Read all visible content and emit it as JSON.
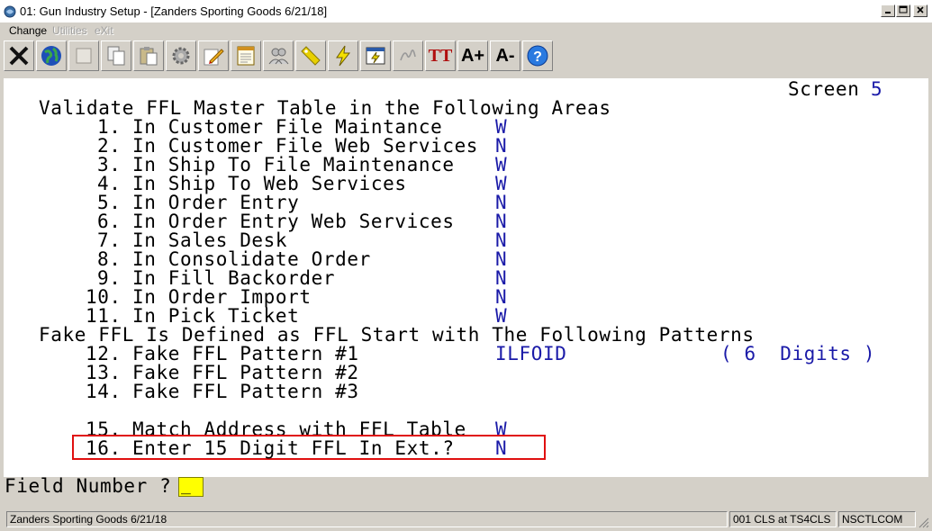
{
  "window": {
    "title": "01: Gun Industry Setup - [Zanders Sporting Goods 6/21/18]",
    "icon": "app-icon",
    "controls": [
      "minimize",
      "maximize",
      "close"
    ]
  },
  "menu": {
    "change": "Change",
    "utilities": "Utilities",
    "exit": "eXit"
  },
  "toolbar": {
    "buttons": [
      "close-x-icon",
      "globe-icon",
      "blank-icon",
      "copy-icon",
      "paste-icon",
      "settings-icon",
      "edit-icon",
      "notes-icon",
      "users-icon",
      "tag-icon",
      "lightning-icon",
      "run-form-icon",
      "signature-icon",
      "font-tt-icon",
      "font-larger-icon",
      "font-smaller-icon",
      "help-icon"
    ],
    "font_tt": "TT",
    "font_larger": "A+",
    "font_smaller": "A-",
    "help": "?"
  },
  "screen": {
    "label": "Screen",
    "number": "5",
    "section1_heading": "Validate FFL Master Table in the Following Areas",
    "fields": [
      {
        "num": "1.",
        "label": "In Customer File Maintance",
        "value": "W"
      },
      {
        "num": "2.",
        "label": "In Customer File Web Services",
        "value": "N"
      },
      {
        "num": "3.",
        "label": "In Ship To File Maintenance",
        "value": "W"
      },
      {
        "num": "4.",
        "label": "In Ship To Web Services",
        "value": "W"
      },
      {
        "num": "5.",
        "label": "In Order Entry",
        "value": "N"
      },
      {
        "num": "6.",
        "label": "In Order Entry Web Services",
        "value": "N"
      },
      {
        "num": "7.",
        "label": "In Sales Desk",
        "value": "N"
      },
      {
        "num": "8.",
        "label": "In Consolidate Order",
        "value": "N"
      },
      {
        "num": "9.",
        "label": "In Fill Backorder",
        "value": "N"
      },
      {
        "num": "10.",
        "label": "In Order Import",
        "value": "N"
      },
      {
        "num": "11.",
        "label": "In Pick Ticket",
        "value": "W"
      }
    ],
    "section2_heading": "Fake FFL Is Defined as FFL Start with The Following Patterns",
    "patterns": [
      {
        "num": "12.",
        "label": "Fake FFL Pattern #1",
        "value": "ILFOID",
        "note": "( 6  Digits )"
      },
      {
        "num": "13.",
        "label": "Fake FFL Pattern #2",
        "value": ""
      },
      {
        "num": "14.",
        "label": "Fake FFL Pattern #3",
        "value": ""
      }
    ],
    "match": {
      "num": "15.",
      "label": "Match Address with FFL Table",
      "value": "W"
    },
    "ext": {
      "num": "16.",
      "label": "Enter 15 Digit FFL In Ext.?",
      "value": "N"
    }
  },
  "command": {
    "prompt": "Field Number ?",
    "value": "_"
  },
  "status": {
    "company": "Zanders Sporting Goods 6/21/18",
    "session": "001 CLS at TS4CLS",
    "system": "NSCTLCOM"
  },
  "colors": {
    "value_blue": "#1a1aa8",
    "highlight_red": "#e01010",
    "input_yellow": "#ffff00"
  }
}
